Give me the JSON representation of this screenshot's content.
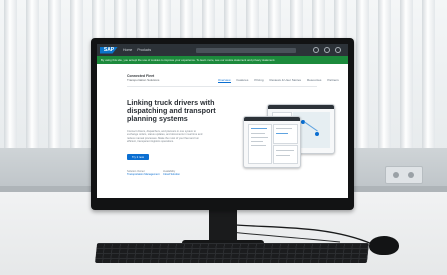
{
  "monitor_screen": {
    "browser_shell": {
      "logo": "SAP",
      "home": "Home",
      "products": "Products"
    },
    "notice_bar": "By using this site, you accept the use of cookies to improve your experience. To learn more, see our cookie statement and privacy statement.",
    "site": {
      "brand_title": "Connected Fleet",
      "brand_subtitle": "Transportation Solutions",
      "nav": [
        "Overview",
        "Features",
        "Pricing",
        "Reviews & User Stories",
        "Resources",
        "Partners"
      ],
      "active_nav": "Overview",
      "headline": "Linking truck drivers with dispatching and transport planning systems",
      "body": "Connect drivers, dispatchers, and planners in one system to exchange orders, status updates, and documents in real time and reduce manual processes. Make the most of your fleet and run efficient, transparent logistics operations.",
      "cta": "Try it now",
      "meta_left_label": "Solution Owner",
      "meta_left_link": "Transportation Management",
      "meta_right_label": "Availability",
      "meta_right_link": "Cloud Solution"
    }
  },
  "colors": {
    "accent": "#0a6ed1",
    "notice": "#1c8a3c",
    "shell": "#2c3238"
  }
}
